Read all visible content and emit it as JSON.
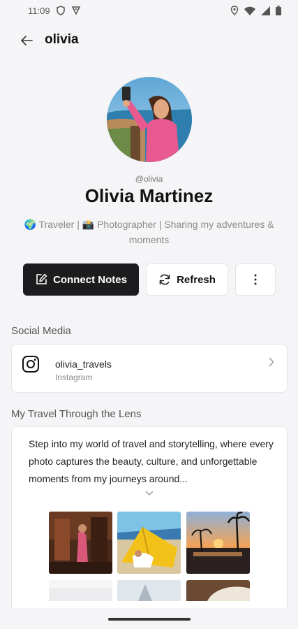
{
  "status": {
    "time": "11:09"
  },
  "header": {
    "title": "olivia"
  },
  "profile": {
    "handle": "@olivia",
    "name": "Olivia Martinez",
    "bio": "🌍 Traveler | 📸 Photographer | Sharing my adventures & moments"
  },
  "actions": {
    "connect_label": "Connect Notes",
    "refresh_label": "Refresh"
  },
  "social": {
    "section_title": "Social Media",
    "items": [
      {
        "username": "olivia_travels",
        "platform": "Instagram",
        "icon": "instagram-icon"
      }
    ]
  },
  "travel": {
    "section_title": "My Travel Through the Lens",
    "description": "Step into my world of travel and storytelling, where every photo captures the beauty, culture, and unforgettable moments from my journeys around..."
  },
  "colors": {
    "primary_button": "#1c1c1e",
    "background": "#f5f5f7",
    "muted_text": "#8a8a8a"
  }
}
